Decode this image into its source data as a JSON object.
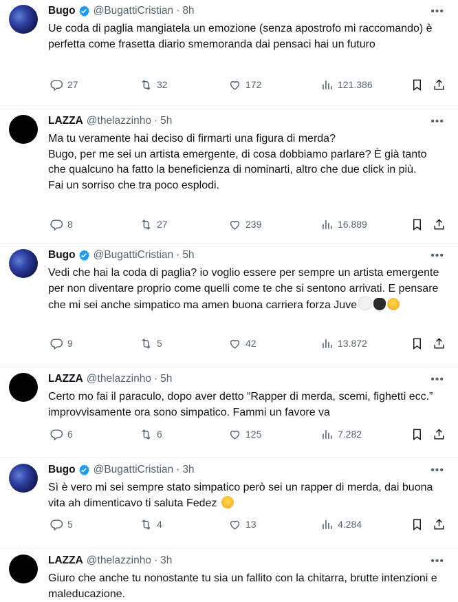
{
  "tweets": [
    {
      "account": "bugo",
      "name": "Bugo",
      "verified": true,
      "handle": "@BugattiCristian",
      "time": "8h",
      "text": "Ue coda di paglia mangiatela un emozione (senza apostrofo mi raccomando) è perfetta come frasetta diario smemoranda dai pensaci hai un futuro",
      "replies": "27",
      "retweets": "32",
      "likes": "172",
      "views": "121.386"
    },
    {
      "account": "lazza",
      "name": "LAZZA",
      "verified": false,
      "handle": "@thelazzinho",
      "time": "5h",
      "text": "Ma tu veramente hai deciso di firmarti una figura di merda?\nBugo, per me sei un artista emergente, di cosa dobbiamo parlare? È già tanto che qualcuno ha fatto la beneficienza di nominarti, altro che due click in più.\nFai un sorriso che tra poco esplodi.",
      "replies": "8",
      "retweets": "27",
      "likes": "239",
      "views": "16.889"
    },
    {
      "account": "bugo",
      "name": "Bugo",
      "verified": true,
      "handle": "@BugattiCristian",
      "time": "5h",
      "text": "Vedi che hai la coda di paglia? io voglio essere per sempre un artista emergente per non diventare proprio come quelli come te che si sentono arrivati. E pensare che mi sei anche simpatico ma amen buona carriera forza Juve",
      "replies": "9",
      "retweets": "5",
      "likes": "42",
      "views": "13.872"
    },
    {
      "account": "lazza",
      "name": "LAZZA",
      "verified": false,
      "handle": "@thelazzinho",
      "time": "5h",
      "text": "Certo mo fai il paraculo, dopo aver detto “Rapper di merda, scemi, fighetti ecc.” improvvisamente ora sono simpatico. Fammi un favore va",
      "replies": "6",
      "retweets": "6",
      "likes": "125",
      "views": "7.282"
    },
    {
      "account": "bugo",
      "name": "Bugo",
      "verified": true,
      "handle": "@BugattiCristian",
      "time": "3h",
      "text": "Sì è vero mi sei sempre stato simpatico però sei un rapper di merda, dai buona vita ah dimenticavo ti saluta Fedez",
      "replies": "5",
      "retweets": "4",
      "likes": "13",
      "views": "4.284"
    },
    {
      "account": "lazza",
      "name": "LAZZA",
      "verified": false,
      "handle": "@thelazzinho",
      "time": "3h",
      "text": "Giuro che anche tu nonostante tu sia un fallito con la chitarra, brutte intenzioni e maleducazione."
    }
  ],
  "separator": "·",
  "more_label": "•••",
  "colors": {
    "verified": "#1d9bf0",
    "muted": "#536471",
    "text": "#0f1419"
  },
  "icons": {
    "verified": "verified-badge-icon",
    "reply": "reply-icon",
    "retweet": "retweet-icon",
    "like": "heart-icon",
    "views": "views-chart-icon",
    "bookmark": "bookmark-icon",
    "share": "share-icon",
    "more": "more-dots-icon"
  }
}
